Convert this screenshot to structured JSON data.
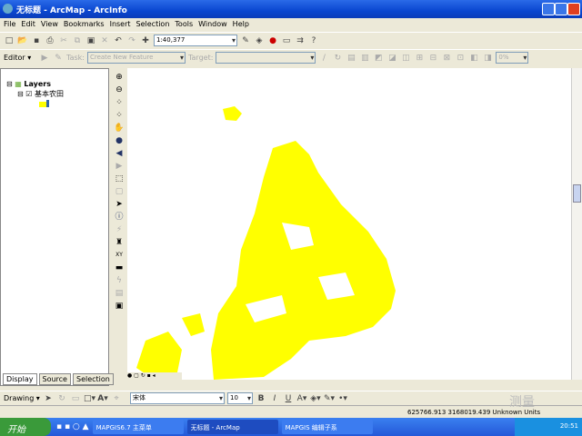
{
  "window": {
    "title": "无标题 - ArcMap - ArcInfo"
  },
  "menu": [
    "File",
    "Edit",
    "View",
    "Bookmarks",
    "Insert",
    "Selection",
    "Tools",
    "Window",
    "Help"
  ],
  "standard_toolbar": {
    "scale": "1:40,377"
  },
  "editor_toolbar": {
    "editor_label": "Editor ▾",
    "task_label": "Task:",
    "task_value": "Create New Feature",
    "target_label": "Target:",
    "zoom_value": "0%"
  },
  "toc": {
    "root": "Layers",
    "layer": "基本农田",
    "tabs": [
      "Display",
      "Source",
      "Selection"
    ]
  },
  "drawing_toolbar": {
    "label": "Drawing ▾",
    "font": "宋体",
    "size": "10",
    "bold": "B",
    "italic": "I",
    "underline": "U"
  },
  "status": {
    "coords": "625766.913  3168019.439 Unknown Units"
  },
  "taskbar": {
    "start": "开始",
    "tasks": [
      "MAPGIS6.7 主菜单",
      "无标题 - ArcMap",
      "MAPGIS 编辑子系"
    ],
    "clock": "20:51"
  },
  "watermark": "测量",
  "colors": {
    "feature": "#ffff00",
    "titlebar": "#0a46d0"
  }
}
